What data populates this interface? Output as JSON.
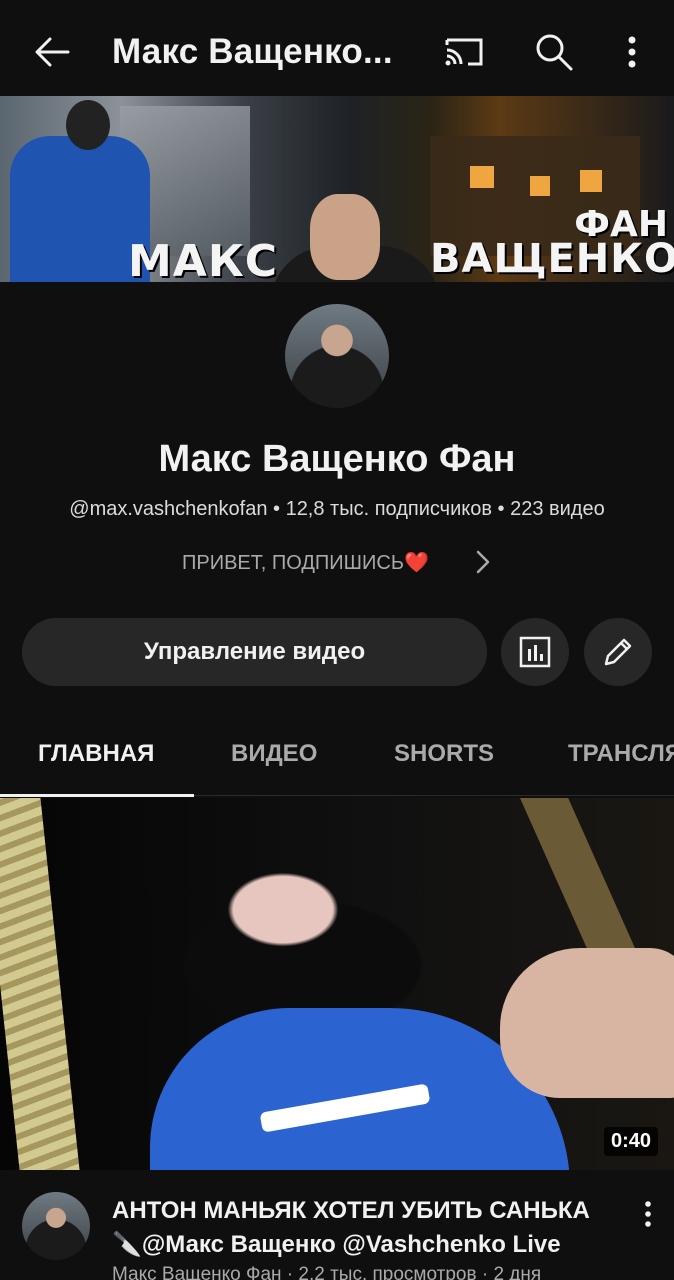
{
  "appbar": {
    "title": "Макс Ващенко...",
    "icons": [
      "back-arrow-icon",
      "cast-icon",
      "search-icon",
      "more-vert-icon"
    ]
  },
  "banner": {
    "text_left": "МАКС",
    "text_right_top": "ФАН",
    "text_right_bottom": "ВАЩЕНКО"
  },
  "channel": {
    "name": "Макс Ващенко Фан",
    "handle": "@max.vashchenkofan",
    "subscribers": "12,8 тыс. подписчиков",
    "videos": "223 видео",
    "meta_line": "@max.vashchenkofan • 12,8 тыс. подписчиков • 223 видео",
    "tagline": "ПРИВЕТ, ПОДПИШИСЬ❤️"
  },
  "actions": {
    "manage_label": "Управление видео",
    "stats_icon": "analytics-icon",
    "edit_icon": "pencil-icon"
  },
  "tabs": [
    {
      "label": "ГЛАВНАЯ",
      "active": true
    },
    {
      "label": "ВИДЕО",
      "active": false
    },
    {
      "label": "SHORTS",
      "active": false
    },
    {
      "label": "ТРАНСЛЯ",
      "active": false
    }
  ],
  "featured_video": {
    "duration": "0:40",
    "title": "АНТОН МАНЬЯК ХОТЕЛ УБИТЬ САНЬКА 🔪@Макс Ващенко @Vashchenko Live",
    "subtitle": "Макс Ващенко Фан · 2,2 тыс. просмотров · 2 дня"
  },
  "colors": {
    "background": "#0f0f0f",
    "button_bg": "#272727",
    "text_primary": "#f1f1f1",
    "text_secondary": "#aaaaaa"
  }
}
